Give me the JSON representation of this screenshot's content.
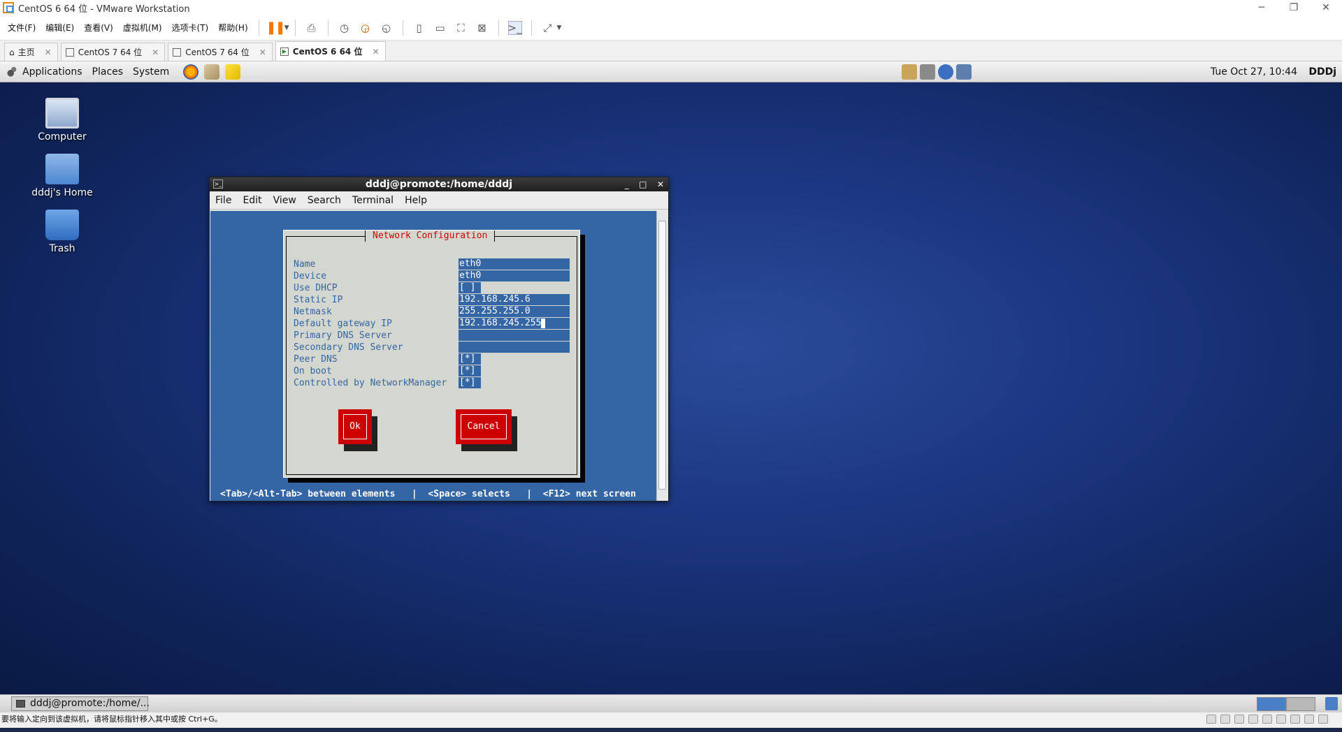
{
  "vmware": {
    "window_title": "CentOS 6 64 位 - VMware Workstation",
    "window_controls": {
      "minimize": "─",
      "restore": "❐",
      "close": "✕"
    },
    "menu": [
      "文件(F)",
      "编辑(E)",
      "查看(V)",
      "虚拟机(M)",
      "选项卡(T)",
      "帮助(H)"
    ],
    "tabs": [
      {
        "label": "主页",
        "close": "✕"
      },
      {
        "label": "CentOS 7 64 位",
        "close": "✕"
      },
      {
        "label": "CentOS 7 64 位",
        "close": "✕"
      },
      {
        "label": "CentOS 6 64 位",
        "close": "✕"
      }
    ],
    "status_text": "要将输入定向到该虚拟机，请将鼠标指针移入其中或按 Ctrl+G。"
  },
  "gnome_panel": {
    "menus": [
      "Applications",
      "Places",
      "System"
    ],
    "clock": "Tue Oct 27, 10:44",
    "user": "DDDj"
  },
  "desktop_icons": [
    {
      "label": "Computer"
    },
    {
      "label": "dddj's Home"
    },
    {
      "label": "Trash"
    }
  ],
  "terminal": {
    "title": "dddj@promote:/home/dddj",
    "menu": [
      "File",
      "Edit",
      "View",
      "Search",
      "Terminal",
      "Help"
    ],
    "buttons": {
      "minimize": "_",
      "maximize": "□",
      "close": "✕"
    }
  },
  "dialog": {
    "title": "Network Configuration",
    "fields": [
      {
        "label": "Name",
        "value": "eth0"
      },
      {
        "label": "Device",
        "value": "eth0"
      },
      {
        "label": "Use DHCP",
        "value": "[ ]"
      },
      {
        "label": "Static IP",
        "value": "192.168.245.6"
      },
      {
        "label": "Netmask",
        "value": "255.255.255.0"
      },
      {
        "label": "Default gateway IP",
        "value": "192.168.245.255"
      },
      {
        "label": "Primary DNS Server",
        "value": ""
      },
      {
        "label": "Secondary DNS Server",
        "value": ""
      },
      {
        "label": "Peer DNS",
        "value": "[*]"
      },
      {
        "label": "On boot",
        "value": "[*]"
      },
      {
        "label": "Controlled by NetworkManager",
        "value": "[*]"
      }
    ],
    "ok_label": "Ok",
    "cancel_label": "Cancel",
    "hint": "<Tab>/<Alt-Tab> between elements   |  <Space> selects   |  <F12> next screen"
  },
  "guest_taskbar": {
    "task_label": "dddj@promote:/home/..."
  }
}
